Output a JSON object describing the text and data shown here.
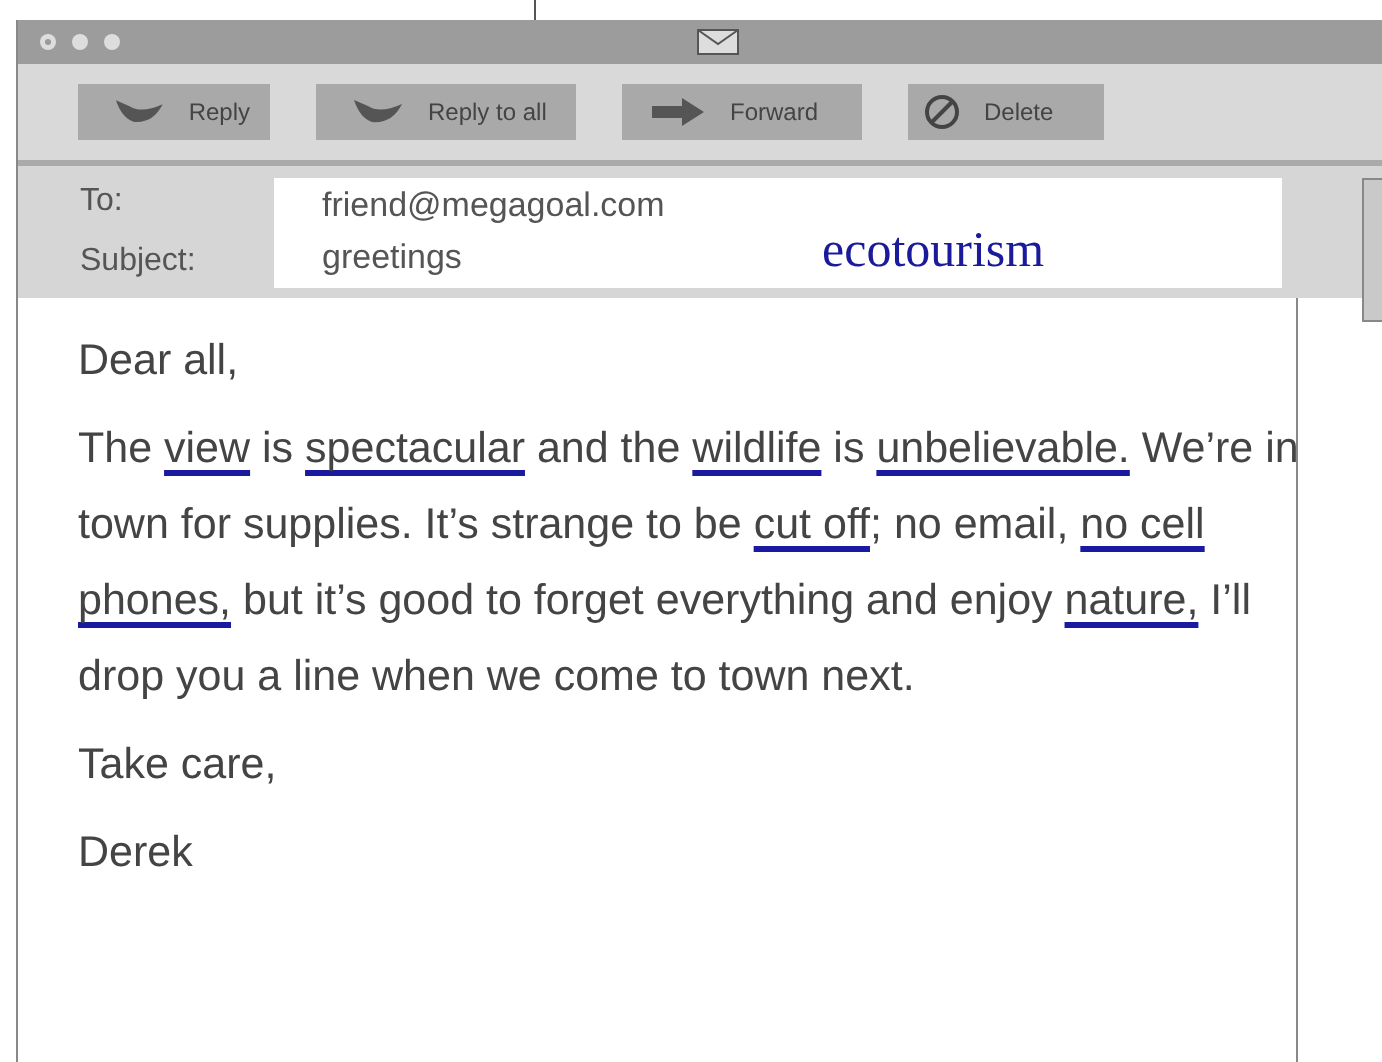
{
  "toolbar": [
    {
      "label": "Reply",
      "kind": "reply"
    },
    {
      "label": "Reply to all",
      "kind": "reply-all"
    },
    {
      "label": "Forward",
      "kind": "forward"
    },
    {
      "label": "Delete",
      "kind": "delete"
    }
  ],
  "header": {
    "to_label": "To:",
    "to": "friend@megagoal.com",
    "subject_label": "Subject:",
    "subject": "greetings",
    "annotation": "ecotourism"
  },
  "body": {
    "greeting": "Dear all,",
    "segments": [
      {
        "text": "The ",
        "underlined": false
      },
      {
        "text": "view",
        "underlined": true
      },
      {
        "text": " is ",
        "underlined": false
      },
      {
        "text": "spectacular",
        "underlined": true
      },
      {
        "text": " and the ",
        "underlined": false
      },
      {
        "text": "wildlife",
        "underlined": true
      },
      {
        "text": " is ",
        "underlined": false
      },
      {
        "text": "unbelievable.",
        "underlined": true
      },
      {
        "text": " We’re in town for supplies. It’s strange to be ",
        "underlined": false
      },
      {
        "text": "cut off",
        "underlined": true
      },
      {
        "text": "; no email, ",
        "underlined": false
      },
      {
        "text": "no cell phones,",
        "underlined": true
      },
      {
        "text": " but it’s good to forget everything and enjoy ",
        "underlined": false
      },
      {
        "text": "nature,",
        "underlined": true
      },
      {
        "text": " I’ll drop you a line when we come to town next.",
        "underlined": false
      }
    ],
    "closing": "Take care,",
    "signature": "Derek"
  }
}
